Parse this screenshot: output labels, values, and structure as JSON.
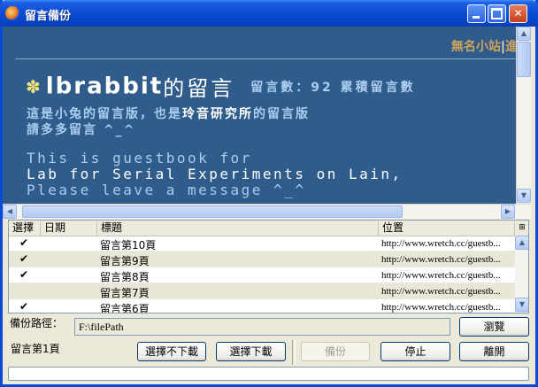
{
  "window": {
    "title": "留言備份"
  },
  "titlebar_buttons": [
    "minimize",
    "maximize",
    "close"
  ],
  "webview": {
    "top_links": {
      "link1": "無名小站",
      "separator": "|",
      "link2": "進入自"
    },
    "heading": {
      "username": "lbrabbit",
      "suffix": "的留言",
      "count_label": "留言數：92 累積留言數"
    },
    "intro": {
      "line1_pre": "這是小兔的留言版，也是",
      "line1_highlight": "玲音研究所",
      "line1_post": "的留言版",
      "line2": "請多多留言 ^_^"
    },
    "english": {
      "line1": "This is guestbook for",
      "line2": "Lab for Serial Experiments on Lain,",
      "line3": "Please leave a message ^_^"
    }
  },
  "table": {
    "columns": [
      "選擇",
      "日期",
      "標題",
      "位置"
    ],
    "rows": [
      {
        "checked": "✔",
        "date": "",
        "title": "留言第10頁",
        "url": "http://www.wretch.cc/guestb..."
      },
      {
        "checked": "✔",
        "date": "",
        "title": "留言第9頁",
        "url": "http://www.wretch.cc/guestb..."
      },
      {
        "checked": "✔",
        "date": "",
        "title": "留言第8頁",
        "url": "http://www.wretch.cc/guestb..."
      },
      {
        "checked": "",
        "date": "",
        "title": "留言第7頁",
        "url": "http://www.wretch.cc/guestb..."
      },
      {
        "checked": "✔",
        "date": "",
        "title": "留言第6頁",
        "url": "http://www.wretch.cc/guestb..."
      }
    ]
  },
  "backup": {
    "path_label": "備份路徑：",
    "path_value": "F:\\filePath",
    "browse": "瀏覽",
    "status_text": "留言第1頁"
  },
  "buttons": {
    "deselect": "選擇不下載",
    "select": "選擇下載",
    "backup": "備份",
    "stop": "停止",
    "exit": "離開"
  },
  "icons": {
    "scroll_up": "▲",
    "scroll_down": "▼",
    "scroll_left": "◀",
    "scroll_right": "▶",
    "flower": "✽",
    "check": "✔"
  }
}
